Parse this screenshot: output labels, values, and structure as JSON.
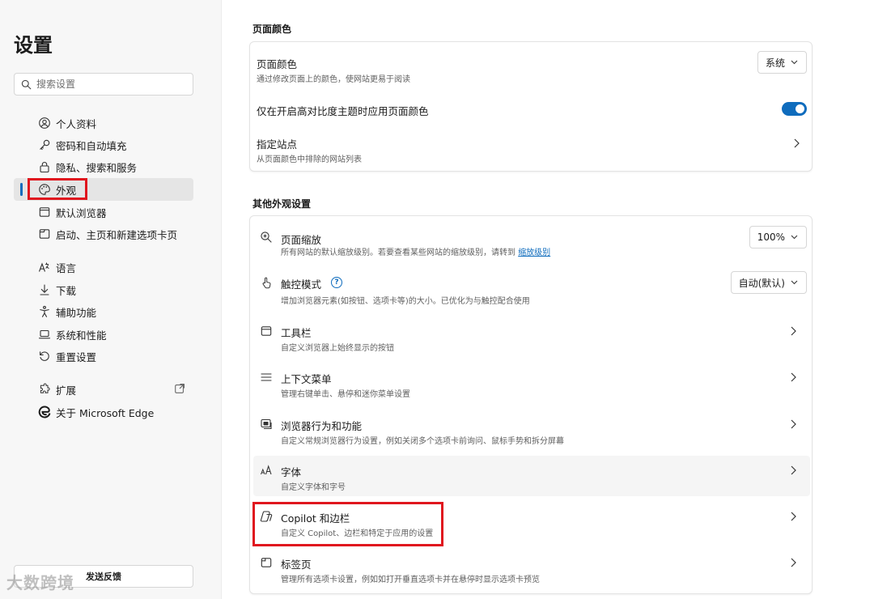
{
  "sidebar": {
    "title": "设置",
    "search_placeholder": "搜索设置",
    "items": [
      {
        "label": "个人资料",
        "icon": "profile-icon"
      },
      {
        "label": "密码和自动填充",
        "icon": "key-icon"
      },
      {
        "label": "隐私、搜索和服务",
        "icon": "lock-icon"
      },
      {
        "label": "外观",
        "icon": "palette-icon",
        "active": true
      },
      {
        "label": "默认浏览器",
        "icon": "browser-icon"
      },
      {
        "label": "启动、主页和新建选项卡页",
        "icon": "home-icon"
      },
      {
        "label": "语言",
        "icon": "language-icon"
      },
      {
        "label": "下载",
        "icon": "download-icon"
      },
      {
        "label": "辅助功能",
        "icon": "accessibility-icon"
      },
      {
        "label": "系统和性能",
        "icon": "laptop-icon"
      },
      {
        "label": "重置设置",
        "icon": "reset-icon"
      },
      {
        "label": "扩展",
        "icon": "puzzle-icon"
      },
      {
        "label": "关于 Microsoft Edge",
        "icon": "edge-logo-icon"
      }
    ],
    "feedback_label": "发送反馈",
    "watermark": "大数跨境"
  },
  "page_color_section": {
    "title": "页面颜色",
    "rows": [
      {
        "title": "页面颜色",
        "desc": "通过修改页面上的颜色，使网站更易于阅读",
        "control": "dropdown",
        "value": "系统"
      },
      {
        "title": "仅在开启高对比度主题时应用页面颜色",
        "control": "toggle",
        "on": true
      },
      {
        "title": "指定站点",
        "desc": "从页面颜色中排除的网站列表",
        "control": "chevron"
      }
    ]
  },
  "other_section": {
    "title": "其他外观设置",
    "rows": [
      {
        "title": "页面缩放",
        "desc": "所有网站的默认缩放级别。若要查看某些网站的缩放级别，请转到",
        "link": "缩放级别",
        "control": "dropdown",
        "value": "100%",
        "icon": "zoom-icon"
      },
      {
        "title": "触控模式",
        "desc": "增加浏览器元素(如按钮、选项卡等)的大小。已优化为与触控配合使用",
        "control": "dropdown",
        "value": "自动(默认)",
        "icon": "touch-icon",
        "help": "?"
      },
      {
        "title": "工具栏",
        "desc": "自定义浏览器上始终显示的按钮",
        "control": "chevron",
        "icon": "toolbar-icon"
      },
      {
        "title": "上下文菜单",
        "desc": "管理右键单击、悬停和迷你菜单设置",
        "control": "chevron",
        "icon": "menu-icon"
      },
      {
        "title": "浏览器行为和功能",
        "desc": "自定义常规浏览器行为设置，例如关闭多个选项卡前询问、鼠标手势和拆分屏幕",
        "control": "chevron",
        "icon": "browser-features-icon"
      },
      {
        "title": "字体",
        "desc": "自定义字体和字号",
        "control": "chevron",
        "icon": "font-icon"
      },
      {
        "title": "Copilot 和边栏",
        "desc": "自定义 Copilot、边栏和特定于应用的设置",
        "control": "chevron",
        "icon": "copilot-icon"
      },
      {
        "title": "标签页",
        "desc": "管理所有选项卡设置，例如如打开垂直选项卡并在悬停时显示选项卡预览",
        "control": "chevron",
        "icon": "tabs-icon"
      }
    ]
  }
}
